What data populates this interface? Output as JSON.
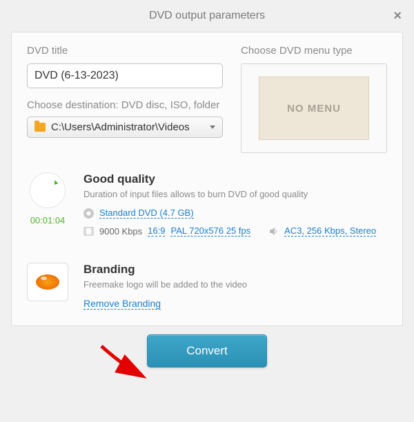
{
  "window": {
    "title": "DVD output parameters"
  },
  "titleField": {
    "label": "DVD title",
    "value": "DVD (6-13-2023)"
  },
  "menu": {
    "label": "Choose DVD menu type",
    "preview": "NO MENU"
  },
  "destination": {
    "label": "Choose destination: DVD disc, ISO, folder",
    "path": "C:\\Users\\Administrator\\Videos"
  },
  "quality": {
    "title": "Good quality",
    "desc": "Duration of input files allows to burn DVD of good quality",
    "duration": "00:01:04",
    "disc_type_label": "Standard DVD (4.7 GB)",
    "bitrate": "9000 Kbps",
    "aspect": "16:9",
    "resolution": "PAL 720x576 25 fps",
    "audio": "AC3, 256 Kbps, Stereo"
  },
  "branding": {
    "title": "Branding",
    "desc": "Freemake logo will be added to the video",
    "remove_link": "Remove Branding"
  },
  "actions": {
    "convert": "Convert"
  }
}
